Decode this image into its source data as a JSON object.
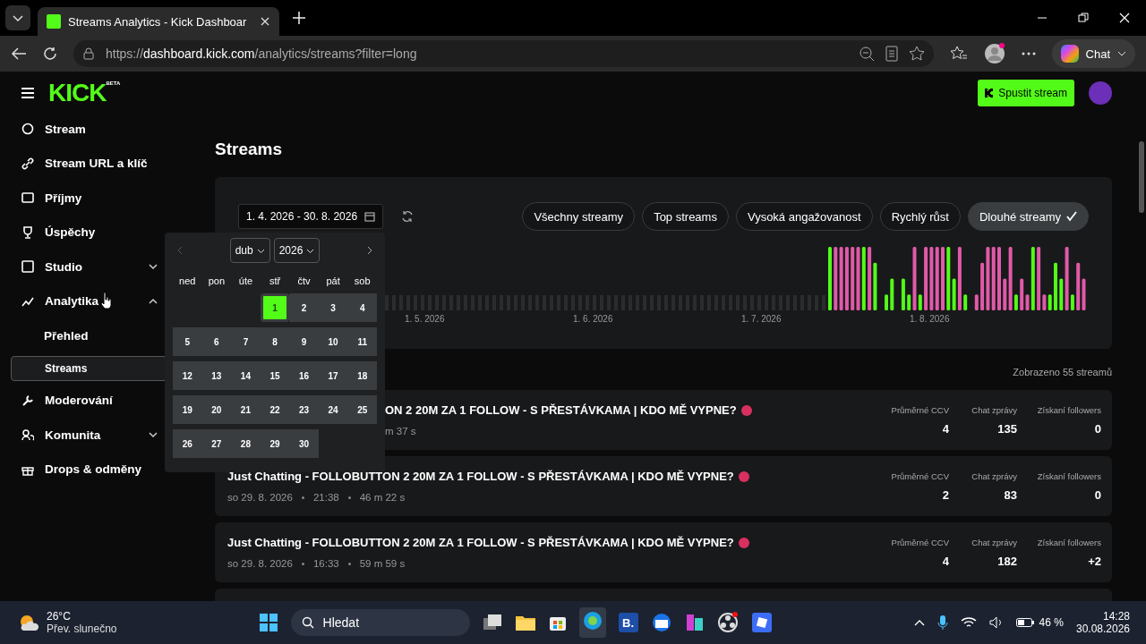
{
  "browser": {
    "tab_title": "Streams Analytics - Kick Dashboar",
    "url_host": "dashboard.kick.com",
    "url_scheme": "https://",
    "url_path": "/analytics/streams?filter=long",
    "chat_label": "Chat"
  },
  "header": {
    "logo": "KICK",
    "logo_badge": "BETA",
    "start_button": "Spustit stream"
  },
  "sidebar": {
    "items": [
      {
        "label": "Stream",
        "selected": false
      },
      {
        "label": "Stream URL a klíč",
        "selected": false
      },
      {
        "label": "Příjmy",
        "selected": false
      },
      {
        "label": "Úspěchy",
        "selected": false
      },
      {
        "label": "Studio",
        "selected": false,
        "expanded": false
      },
      {
        "label": "Analytika",
        "selected": false,
        "expanded": true,
        "children": [
          {
            "label": "Přehled",
            "selected": false
          },
          {
            "label": "Streams",
            "selected": true
          }
        ]
      },
      {
        "label": "Moderování",
        "selected": false
      },
      {
        "label": "Komunita",
        "selected": false,
        "expanded": false
      },
      {
        "label": "Drops & odměny",
        "selected": false
      }
    ]
  },
  "page_title": "Streams",
  "date_range": {
    "value": "1. 4. 2026 - 30. 8. 2026"
  },
  "filters": [
    {
      "label": "Všechny streamy",
      "selected": false
    },
    {
      "label": "Top streams",
      "selected": false
    },
    {
      "label": "Vysoká angažovanost",
      "selected": false
    },
    {
      "label": "Rychlý růst",
      "selected": false
    },
    {
      "label": "Dlouhé streamy",
      "selected": true
    }
  ],
  "chart_axis_labels": [
    "1. 5. 2026",
    "1. 6. 2026",
    "1. 7. 2026",
    "1. 8. 2026"
  ],
  "calendar": {
    "month": "dub",
    "year": "2026",
    "weekdays": [
      "ned",
      "pon",
      "úte",
      "stř",
      "čtv",
      "pát",
      "sob"
    ],
    "weeks": [
      [
        {
          "label": "1",
          "selected": true
        },
        {
          "label": "2",
          "selected": false
        },
        {
          "label": "3",
          "selected": false
        },
        {
          "label": "4",
          "selected": false
        }
      ],
      [
        {
          "label": "5",
          "selected": false
        },
        {
          "label": "6",
          "selected": false
        },
        {
          "label": "7",
          "selected": false
        },
        {
          "label": "8",
          "selected": false
        },
        {
          "label": "9",
          "selected": false
        },
        {
          "label": "10",
          "selected": false
        },
        {
          "label": "11",
          "selected": false
        }
      ],
      [
        {
          "label": "12",
          "selected": false
        },
        {
          "label": "13",
          "selected": false
        },
        {
          "label": "14",
          "selected": false
        },
        {
          "label": "15",
          "selected": false
        },
        {
          "label": "16",
          "selected": false
        },
        {
          "label": "17",
          "selected": false
        },
        {
          "label": "18",
          "selected": false
        }
      ],
      [
        {
          "label": "19",
          "selected": false
        },
        {
          "label": "20",
          "selected": false
        },
        {
          "label": "21",
          "selected": false
        },
        {
          "label": "22",
          "selected": false
        },
        {
          "label": "23",
          "selected": false
        },
        {
          "label": "24",
          "selected": false
        },
        {
          "label": "25",
          "selected": false
        }
      ],
      [
        {
          "label": "26",
          "selected": false
        },
        {
          "label": "27",
          "selected": false
        },
        {
          "label": "28",
          "selected": false
        },
        {
          "label": "29",
          "selected": false
        },
        {
          "label": "30",
          "selected": false
        }
      ]
    ]
  },
  "count_label": "Zobrazeno 55 streamů",
  "streams": [
    {
      "covered": true,
      "title": "ON 2 20M ZA 1 FOLLOW - S PŘESTÁVKAMA | KDO MĚ VYPNE?",
      "meta": [
        "m 37 s"
      ],
      "stats": [
        {
          "label": "Průměrné CCV",
          "value": "4"
        },
        {
          "label": "Chat zprávy",
          "value": "135"
        },
        {
          "label": "Získaní followers",
          "value": "0"
        }
      ]
    },
    {
      "covered": false,
      "title": "Just Chatting - FOLLOBUTTON 2 20M ZA 1 FOLLOW - S PŘESTÁVKAMA | KDO MĚ VYPNE?",
      "meta": [
        "so 29. 8. 2026",
        "21:38",
        "46 m 22 s"
      ],
      "stats": [
        {
          "label": "Průměrné CCV",
          "value": "2"
        },
        {
          "label": "Chat zprávy",
          "value": "83"
        },
        {
          "label": "Získaní followers",
          "value": "0"
        }
      ]
    },
    {
      "covered": false,
      "title": "Just Chatting - FOLLOBUTTON 2 20M ZA 1 FOLLOW - S PŘESTÁVKAMA | KDO MĚ VYPNE?",
      "meta": [
        "so 29. 8. 2026",
        "16:33",
        "59 m 59 s"
      ],
      "stats": [
        {
          "label": "Průměrné CCV",
          "value": "4"
        },
        {
          "label": "Chat zprávy",
          "value": "182"
        },
        {
          "label": "Získaní followers",
          "value": "+2"
        }
      ]
    }
  ],
  "taskbar": {
    "temperature": "26°C",
    "weather": "Přev. slunečno",
    "search_placeholder": "Hledat",
    "app_letter": "B.",
    "battery": "46 %",
    "time": "14:28",
    "date": "30.08.2026"
  }
}
